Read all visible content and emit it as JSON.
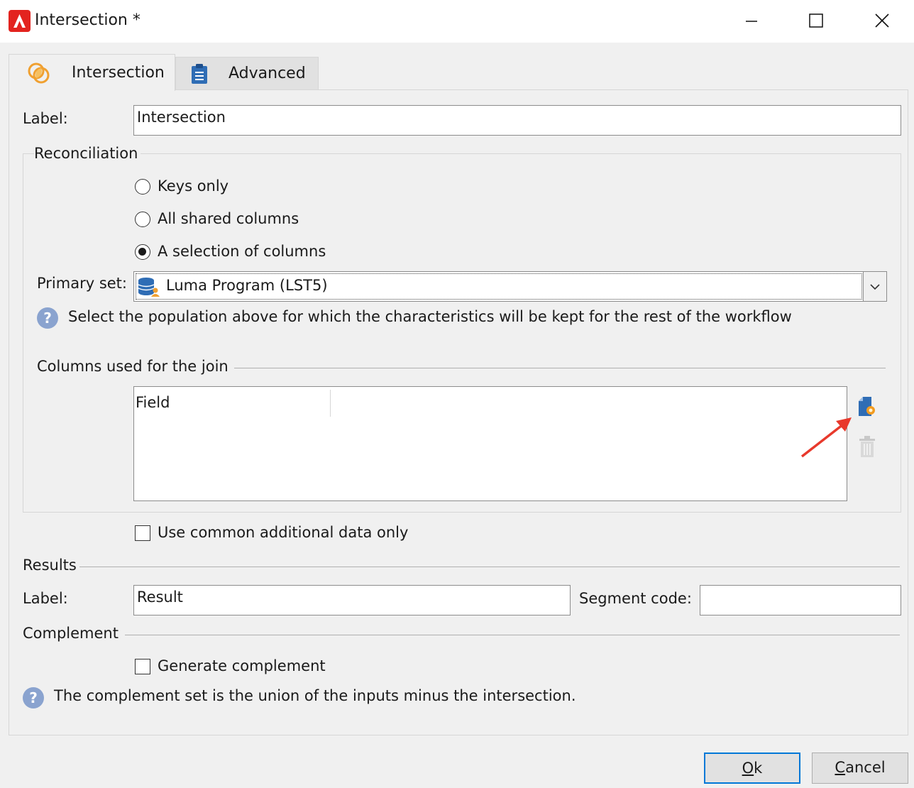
{
  "window": {
    "title": "Intersection *"
  },
  "tabs": [
    {
      "label": "Intersection",
      "icon": "intersection-icon"
    },
    {
      "label": "Advanced",
      "icon": "clipboard-icon"
    }
  ],
  "form": {
    "label_caption": "Label:",
    "label_value": "Intersection"
  },
  "reconciliation": {
    "legend": "Reconciliation",
    "options": [
      {
        "label": "Keys only",
        "selected": false
      },
      {
        "label": "All shared columns",
        "selected": false
      },
      {
        "label": "A selection of columns",
        "selected": true
      }
    ],
    "primary_set_caption": "Primary set:",
    "primary_set_value": "Luma Program (LST5)",
    "primary_set_help": "Select the population above for which the characteristics will be kept for the rest of the workflow",
    "join_legend": "Columns used for the join",
    "join_table": {
      "columns": [
        "Field"
      ],
      "rows": []
    }
  },
  "common_data": {
    "label": "Use common additional data only",
    "checked": false
  },
  "results": {
    "legend": "Results",
    "label_caption": "Label:",
    "label_value": "Result",
    "segment_caption": "Segment code:",
    "segment_value": ""
  },
  "complement": {
    "legend": "Complement",
    "generate_label": "Generate complement",
    "generate_checked": false,
    "help": "The complement set is the union of the inputs minus the intersection."
  },
  "buttons": {
    "ok_mnemonic": "O",
    "ok_rest": "k",
    "cancel_mnemonic": "C",
    "cancel_rest": "ancel"
  },
  "colors": {
    "accent": "#0078d7",
    "annotation_arrow": "#e8392c",
    "help_icon": "#8aa3cf"
  }
}
